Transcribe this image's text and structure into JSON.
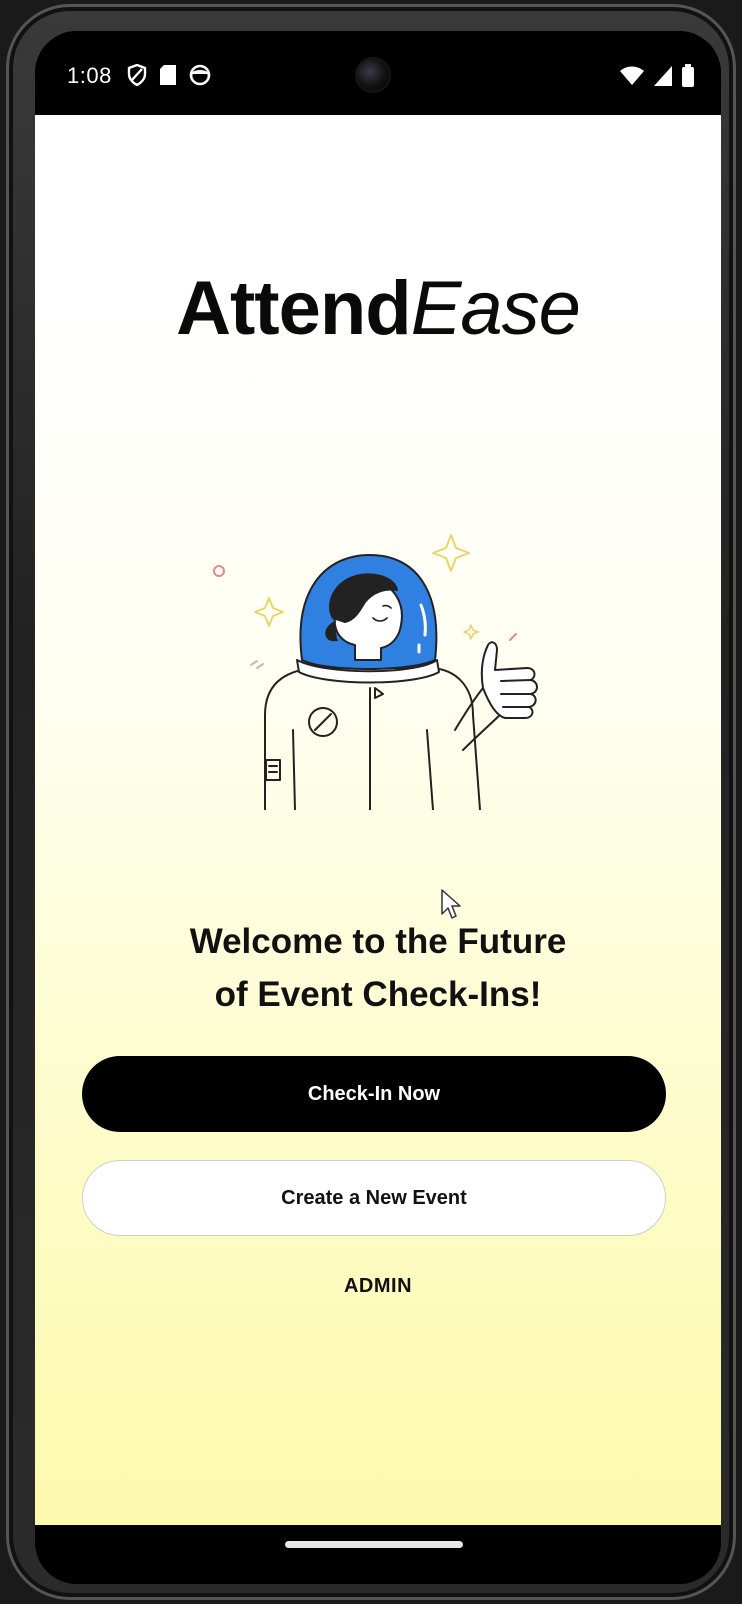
{
  "status_bar": {
    "time": "1:08",
    "left_icons": [
      "shield-icon",
      "sd-card-icon",
      "face-icon"
    ],
    "right_icons": [
      "wifi-icon",
      "signal-icon",
      "battery-icon"
    ]
  },
  "app": {
    "logo_bold": "Attend",
    "logo_light": "Ease",
    "welcome_line1": "Welcome to the Future",
    "welcome_line2": "of Event Check-Ins!",
    "buttons": {
      "check_in": "Check-In Now",
      "create_event": "Create a New Event",
      "admin": "ADMIN"
    },
    "illustration": "astronaut-thumbs-up-illustration"
  },
  "colors": {
    "primary_button": "#000000",
    "background_top": "#ffffff",
    "background_bottom": "#fdf9ad",
    "helmet_blue": "#2f80e0"
  }
}
